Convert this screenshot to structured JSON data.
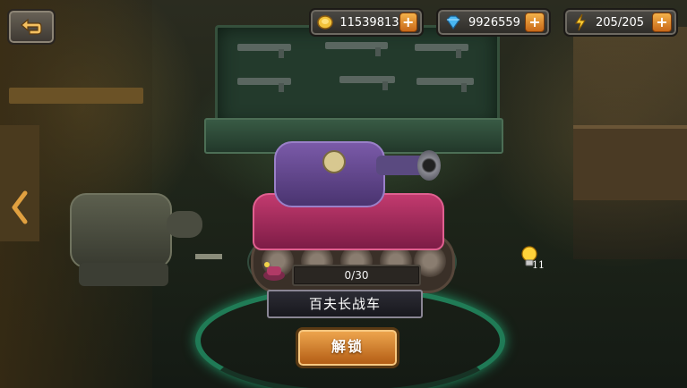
{
  "top_bar": {
    "gold": {
      "value": "11539813",
      "icon": "gold-coin-icon",
      "add_icon": "plus-icon"
    },
    "gems": {
      "value": "9926559",
      "icon": "blue-gem-icon",
      "add_icon": "plus-icon"
    },
    "energy": {
      "value": "205/205",
      "icon": "lightning-icon",
      "add_icon": "plus-icon"
    },
    "plus_label": "+"
  },
  "back_button": {
    "icon": "back-arrow-icon"
  },
  "navigation": {
    "left_arrow_icon": "chevron-left-icon"
  },
  "tank": {
    "name": "百夫长战车",
    "fragments": "0/30",
    "fragments_progress": 0
  },
  "unlock_button": {
    "label": "解锁"
  },
  "hint": {
    "icon": "lightbulb-icon",
    "count": "11"
  },
  "colors": {
    "accent_orange": "#e08a2c",
    "platform_glow": "#28c88c",
    "tank_primary": "#c23a6e"
  }
}
